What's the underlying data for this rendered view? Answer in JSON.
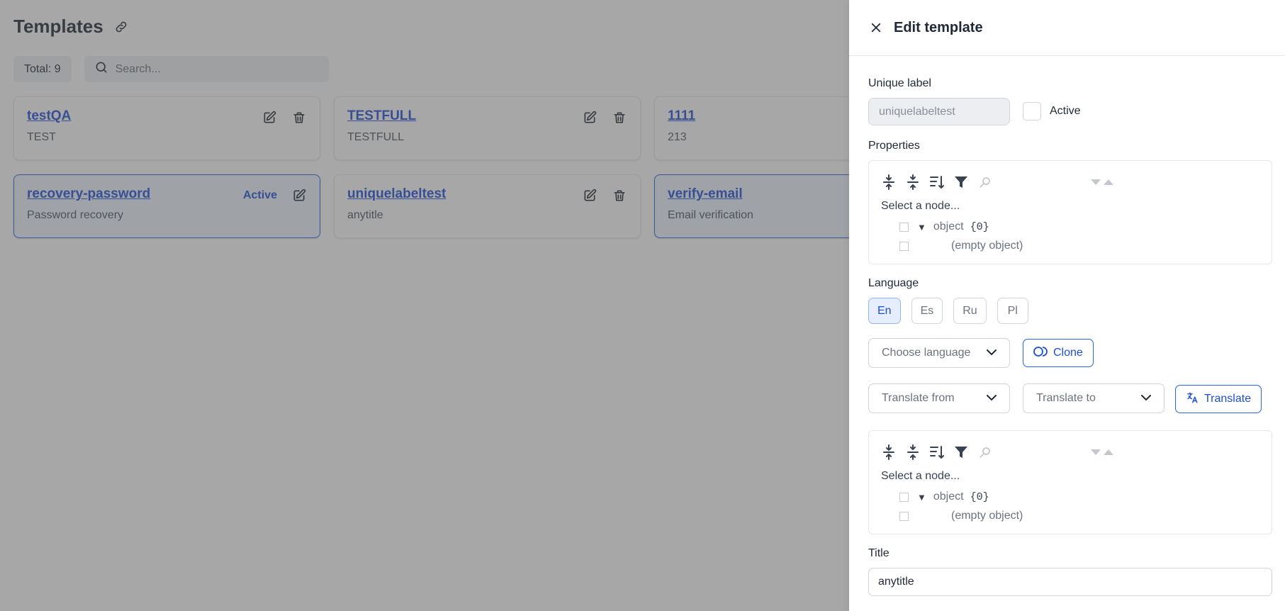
{
  "page": {
    "title": "Templates",
    "total_label": "Total: 9",
    "search_placeholder": "Search..."
  },
  "cards": [
    {
      "label": "testQA",
      "title": "TEST",
      "active": false,
      "active_text": ""
    },
    {
      "label": "TESTFULL",
      "title": "TESTFULL",
      "active": false,
      "active_text": ""
    },
    {
      "label": "1111",
      "title": "213",
      "active": false,
      "active_text": ""
    },
    {
      "label": "recovery-password",
      "title": "Password recovery",
      "active": true,
      "active_text": "Active"
    },
    {
      "label": "uniquelabeltest",
      "title": "anytitle",
      "active": false,
      "active_text": ""
    },
    {
      "label": "verify-email",
      "title": "Email verification",
      "active": true,
      "active_text": ""
    }
  ],
  "drawer": {
    "title": "Edit template",
    "unique_label": {
      "label": "Unique label",
      "value": "uniquelabeltest"
    },
    "active_checkbox": {
      "label": "Active",
      "checked": false
    },
    "properties": {
      "label": "Properties",
      "select_node": "Select a node...",
      "root_name": "object",
      "root_count": "{0}",
      "empty_text": "(empty object)"
    },
    "language": {
      "label": "Language",
      "tabs": [
        "En",
        "Es",
        "Ru",
        "Pl"
      ],
      "selected": "En",
      "choose_placeholder": "Choose language",
      "clone_label": "Clone",
      "translate_from": "Translate from",
      "translate_to": "Translate to",
      "translate_label": "Translate"
    },
    "content_tree": {
      "select_node": "Select a node...",
      "root_name": "object",
      "root_count": "{0}",
      "empty_text": "(empty object)"
    },
    "title_field": {
      "label": "Title",
      "value": "anytitle"
    }
  },
  "colors": {
    "accent": "#1d4ed8",
    "active_card_bg": "#eff4ff",
    "overlay": "rgba(80,80,80,0.5)"
  }
}
